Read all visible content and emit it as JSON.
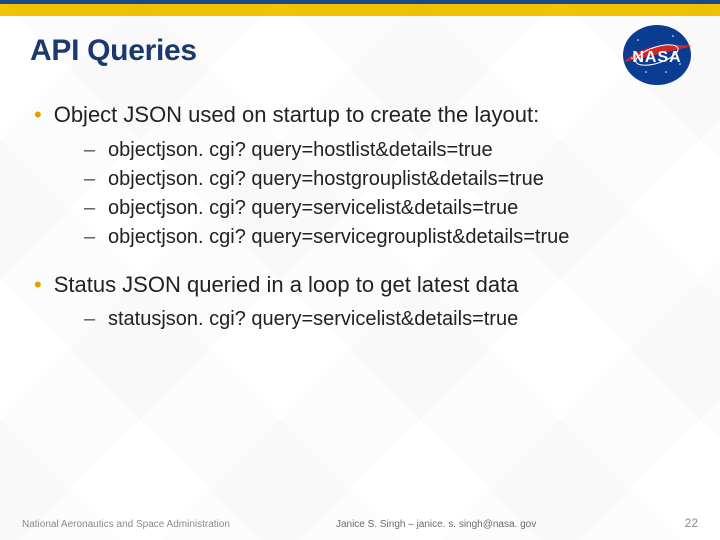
{
  "header": {
    "title": "API Queries",
    "logo_name": "nasa-logo"
  },
  "content": {
    "bullets": [
      {
        "text": "Object JSON used on startup to create the layout:",
        "subs": [
          "objectjson. cgi? query=hostlist&details=true",
          "objectjson. cgi? query=hostgrouplist&details=true",
          "objectjson. cgi? query=servicelist&details=true",
          "objectjson. cgi? query=servicegrouplist&details=true"
        ]
      },
      {
        "text": "Status JSON queried in a loop to get latest data",
        "subs": [
          "statusjson. cgi? query=servicelist&details=true"
        ]
      }
    ]
  },
  "footer": {
    "left": "National Aeronautics and Space Administration",
    "center": "Janice S. Singh – janice. s. singh@nasa. gov",
    "page": "22"
  },
  "colors": {
    "title": "#1a3a6e",
    "gold": "#f5c400",
    "bullet_dot": "#dca300"
  }
}
